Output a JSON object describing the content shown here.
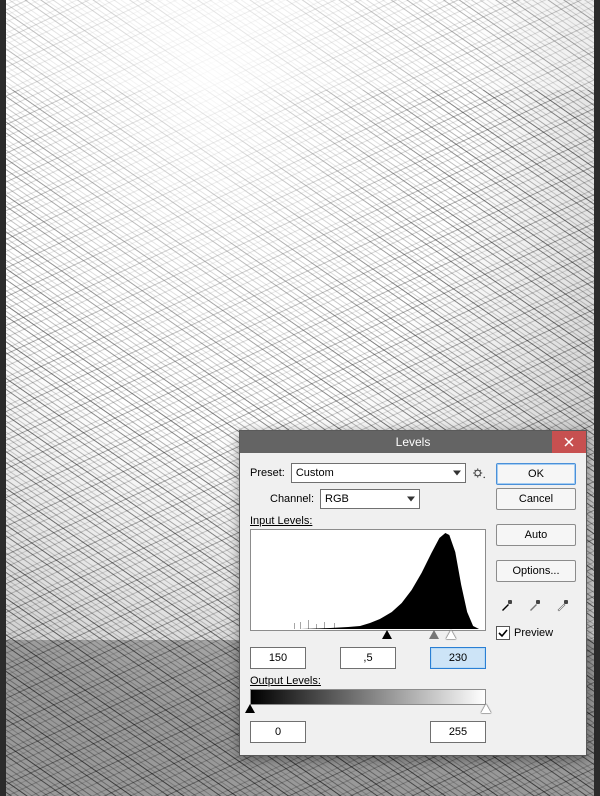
{
  "dialog": {
    "title": "Levels",
    "preset_label": "Preset:",
    "preset_value": "Custom",
    "channel_label": "Channel:",
    "channel_value": "RGB",
    "input_levels_label": "Input Levels:",
    "output_levels_label": "Output Levels:",
    "input_black": "150",
    "input_gamma": ",5",
    "input_white": "230",
    "output_black": "0",
    "output_white": "255",
    "preview_label": "Preview",
    "preview_checked": true
  },
  "buttons": {
    "ok": "OK",
    "cancel": "Cancel",
    "auto": "Auto",
    "options": "Options..."
  },
  "sliders": {
    "input_black_pos_pct": 58,
    "input_gamma_pos_pct": 78,
    "input_white_pos_pct": 85,
    "output_black_pos_pct": 0,
    "output_white_pos_pct": 100
  }
}
